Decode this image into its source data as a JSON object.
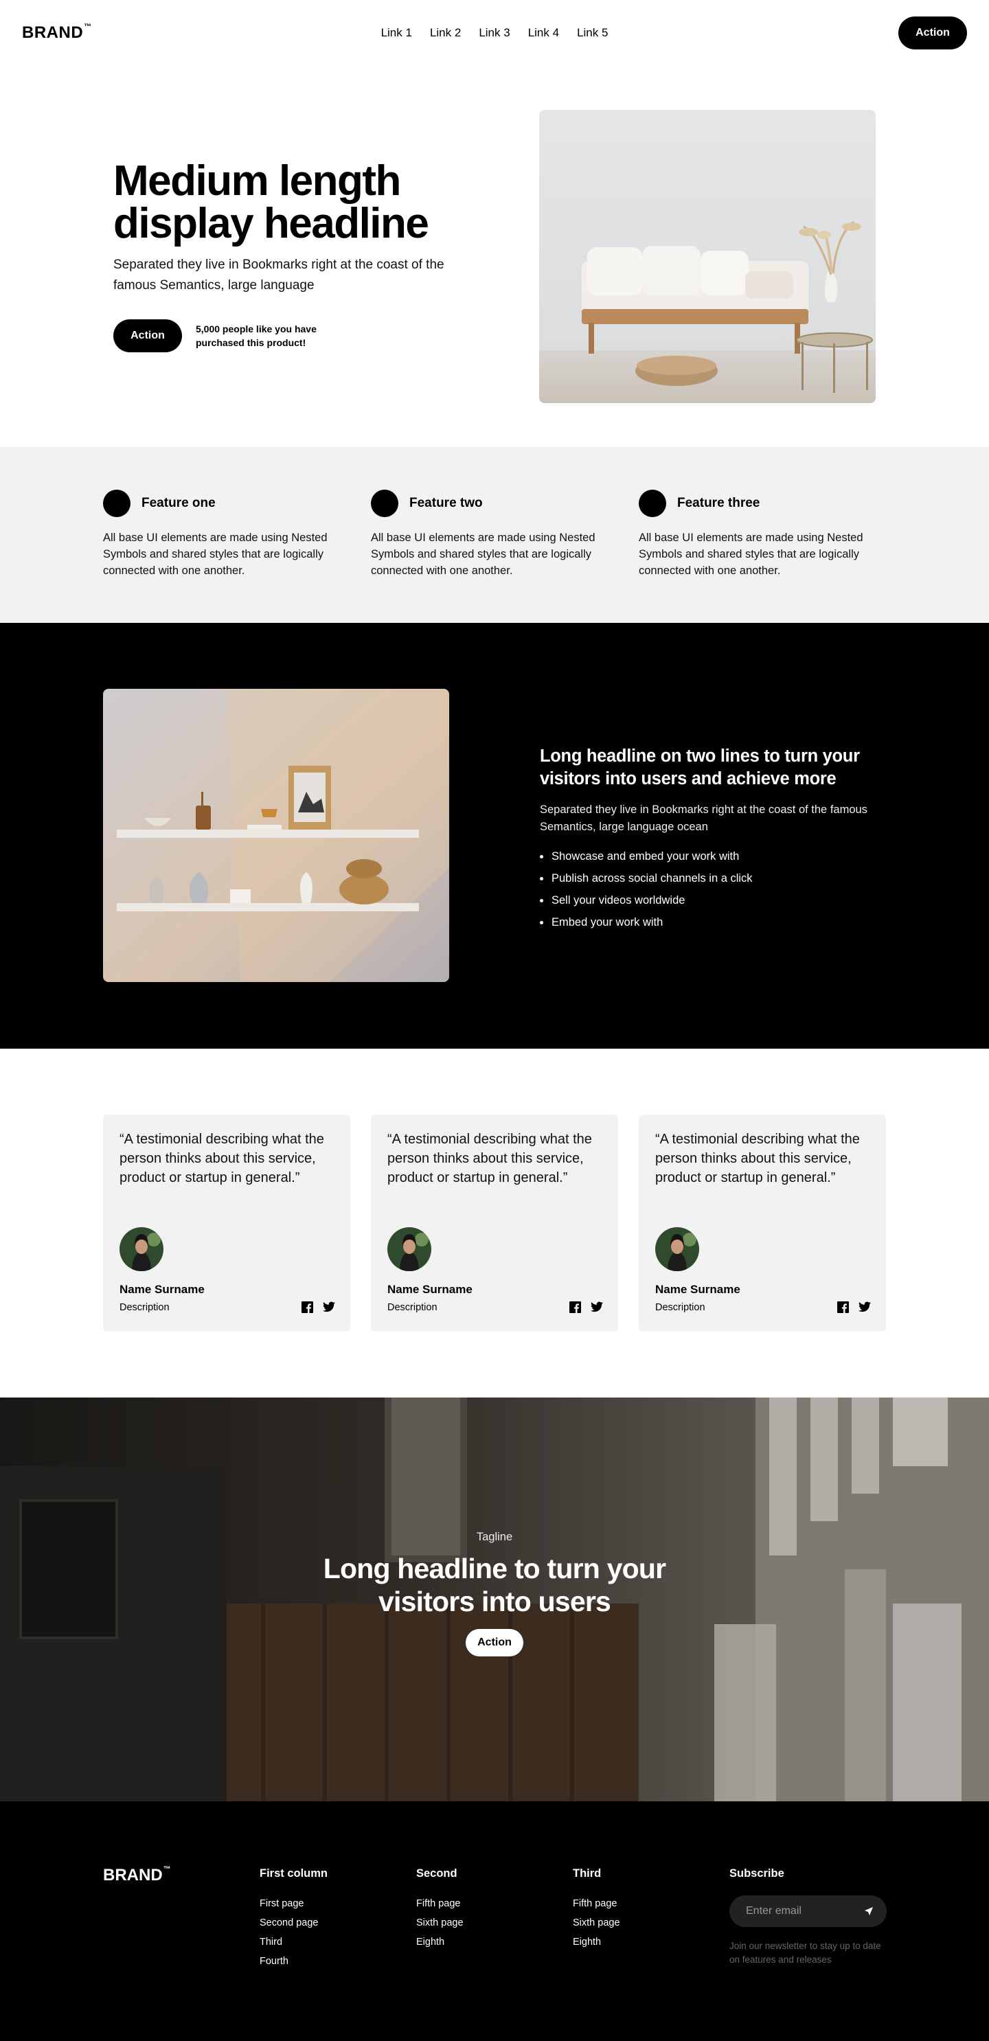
{
  "nav": {
    "brand": "BRAND",
    "brand_mark": "™",
    "links": [
      "Link 1",
      "Link 2",
      "Link 3",
      "Link 4",
      "Link 5"
    ],
    "action_label": "Action"
  },
  "hero": {
    "headline": "Medium length display headline",
    "subtitle": "Separated they live in Bookmarks right at the coast of the famous Semantics, large language",
    "action_label": "Action",
    "social_proof": "5,000 people like you have purchased this product!"
  },
  "features": [
    {
      "title": "Feature one",
      "text": "All base UI elements are made using Nested Symbols and shared styles that are logically connected with one another."
    },
    {
      "title": "Feature two",
      "text": "All base UI elements are made using Nested Symbols and shared styles that are logically connected with one another."
    },
    {
      "title": "Feature three",
      "text": "All base UI elements are made using Nested Symbols and shared styles that are logically connected with one another."
    }
  ],
  "showcase": {
    "headline": "Long headline on two lines to turn your visitors into users and achieve more",
    "text": "Separated they live in Bookmarks right at the coast of the famous Semantics, large language ocean",
    "bullets": [
      "Showcase and embed your work with",
      "Publish across social channels in a click",
      "Sell your videos worldwide",
      "Embed your work with"
    ]
  },
  "testimonials": [
    {
      "quote": "“A testimonial describing what the person thinks about this service, product or startup in general.”",
      "name": "Name Surname",
      "description": "Description"
    },
    {
      "quote": "“A testimonial describing what the person thinks about this service, product or startup in general.”",
      "name": "Name Surname",
      "description": "Description"
    },
    {
      "quote": "“A testimonial describing what the person thinks about this service, product or startup in general.”",
      "name": "Name Surname",
      "description": "Description"
    }
  ],
  "cta": {
    "tagline": "Tagline",
    "headline": "Long headline to turn your visitors into users",
    "action_label": "Action"
  },
  "footer": {
    "brand": "BRAND",
    "brand_mark": "™",
    "columns": [
      {
        "title": "First column",
        "links": [
          "First page",
          "Second page",
          "Third",
          "Fourth"
        ]
      },
      {
        "title": "Second",
        "links": [
          "Fifth page",
          "Sixth page",
          "Eighth"
        ]
      },
      {
        "title": "Third",
        "links": [
          "Fifth page",
          "Sixth page",
          "Eighth"
        ]
      }
    ],
    "subscribe": {
      "title": "Subscribe",
      "placeholder": "Enter email",
      "note": "Join our newsletter to stay up to date on features and releases"
    }
  },
  "colors": {
    "primary": "#000000",
    "light_section": "#f2f2f2",
    "white": "#ffffff"
  },
  "icons": [
    "facebook-icon",
    "twitter-icon",
    "send-icon"
  ]
}
